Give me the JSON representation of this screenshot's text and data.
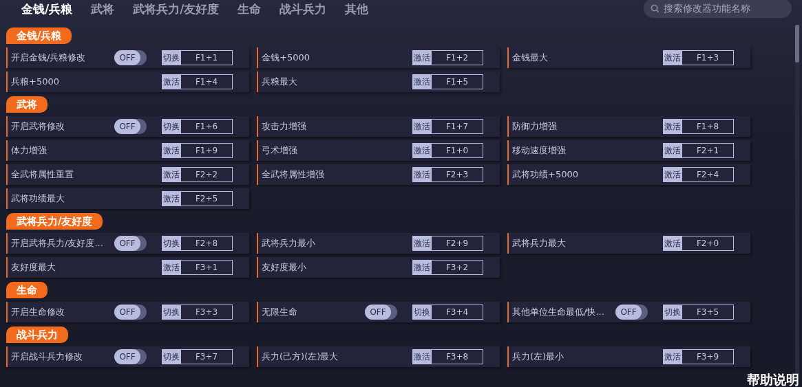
{
  "tabs": [
    {
      "label": "金钱/兵粮",
      "selected": true
    },
    {
      "label": "武将",
      "selected": false
    },
    {
      "label": "武将兵力/友好度",
      "selected": false
    },
    {
      "label": "生命",
      "selected": false
    },
    {
      "label": "战斗兵力",
      "selected": false
    },
    {
      "label": "其他",
      "selected": false
    }
  ],
  "search": {
    "placeholder": "搜索修改器功能名称"
  },
  "sections": [
    {
      "title": "金钱/兵粮",
      "items": [
        {
          "kind": "toggle",
          "label": "开启金钱/兵粮修改",
          "switch": {
            "on": false,
            "text": "OFF"
          },
          "action": "切换",
          "hotkey": "F1+1"
        },
        {
          "kind": "button",
          "label": "金钱+5000",
          "action": "激活",
          "hotkey": "F1+2"
        },
        {
          "kind": "button",
          "label": "金钱最大",
          "action": "激活",
          "hotkey": "F1+3"
        },
        {
          "kind": "button",
          "label": "兵粮+5000",
          "action": "激活",
          "hotkey": "F1+4"
        },
        {
          "kind": "button",
          "label": "兵粮最大",
          "action": "激活",
          "hotkey": "F1+5"
        }
      ]
    },
    {
      "title": "武将",
      "items": [
        {
          "kind": "toggle",
          "label": "开启武将修改",
          "switch": {
            "on": false,
            "text": "OFF"
          },
          "action": "切换",
          "hotkey": "F1+6"
        },
        {
          "kind": "button",
          "label": "攻击力增强",
          "action": "激活",
          "hotkey": "F1+7"
        },
        {
          "kind": "button",
          "label": "防御力增强",
          "action": "激活",
          "hotkey": "F1+8"
        },
        {
          "kind": "button",
          "label": "体力增强",
          "action": "激活",
          "hotkey": "F1+9"
        },
        {
          "kind": "button",
          "label": "弓术增强",
          "action": "激活",
          "hotkey": "F1+0"
        },
        {
          "kind": "button",
          "label": "移动速度增强",
          "action": "激活",
          "hotkey": "F2+1"
        },
        {
          "kind": "button",
          "label": "全武将属性重置",
          "action": "激活",
          "hotkey": "F2+2"
        },
        {
          "kind": "button",
          "label": "全武将属性增强",
          "action": "激活",
          "hotkey": "F2+3"
        },
        {
          "kind": "button",
          "label": "武将功绩+5000",
          "action": "激活",
          "hotkey": "F2+4"
        },
        {
          "kind": "button",
          "label": "武将功绩最大",
          "action": "激活",
          "hotkey": "F2+5"
        }
      ]
    },
    {
      "title": "武将兵力/友好度",
      "items": [
        {
          "kind": "toggle",
          "label": "开启武将兵力/友好度...",
          "switch": {
            "on": false,
            "text": "OFF"
          },
          "action": "切换",
          "hotkey": "F2+8"
        },
        {
          "kind": "button",
          "label": "武将兵力最小",
          "action": "激活",
          "hotkey": "F2+9"
        },
        {
          "kind": "button",
          "label": "武将兵力最大",
          "action": "激活",
          "hotkey": "F2+0"
        },
        {
          "kind": "button",
          "label": "友好度最大",
          "action": "激活",
          "hotkey": "F3+1"
        },
        {
          "kind": "button",
          "label": "友好度最小",
          "action": "激活",
          "hotkey": "F3+2"
        }
      ]
    },
    {
      "title": "生命",
      "items": [
        {
          "kind": "toggle",
          "label": "开启生命修改",
          "switch": {
            "on": false,
            "text": "OFF"
          },
          "action": "切换",
          "hotkey": "F3+3"
        },
        {
          "kind": "toggle",
          "label": "无限生命",
          "switch": {
            "on": false,
            "text": "OFF"
          },
          "action": "切换",
          "hotkey": "F3+4"
        },
        {
          "kind": "toggle",
          "label": "其他单位生命最低/快...",
          "switch": {
            "on": false,
            "text": "OFF"
          },
          "action": "切换",
          "hotkey": "F3+5"
        }
      ]
    },
    {
      "title": "战斗兵力",
      "items": [
        {
          "kind": "toggle",
          "label": "开启战斗兵力修改",
          "switch": {
            "on": false,
            "text": "OFF"
          },
          "action": "切换",
          "hotkey": "F3+7"
        },
        {
          "kind": "button",
          "label": "兵力(己方)(左)最大",
          "action": "激活",
          "hotkey": "F3+8"
        },
        {
          "kind": "button",
          "label": "兵力(左)最小",
          "action": "激活",
          "hotkey": "F3+9"
        }
      ]
    }
  ],
  "help_button": "帮助说明"
}
